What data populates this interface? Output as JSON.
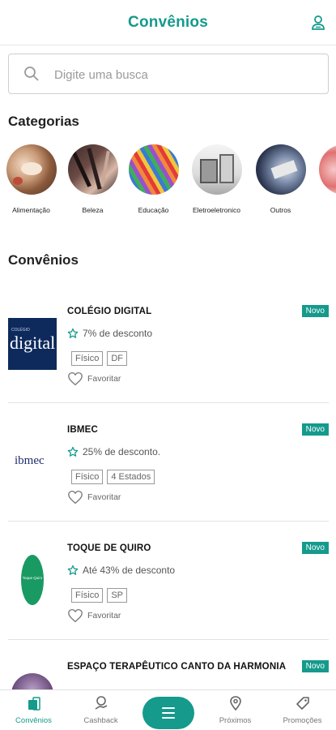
{
  "header": {
    "title": "Convênios",
    "profile_icon": "user-icon"
  },
  "search": {
    "placeholder": "Digite uma busca",
    "icon": "search-icon"
  },
  "categories_title": "Categorias",
  "categories": [
    {
      "label": "Alimentação"
    },
    {
      "label": "Beleza"
    },
    {
      "label": "Educação"
    },
    {
      "label": "Eletroeletronico"
    },
    {
      "label": "Outros"
    }
  ],
  "convenios_title": "Convênios",
  "cards": [
    {
      "name": "COLÉGIO DIGITAL",
      "badge": "Novo",
      "discount": "7% de desconto",
      "tags": [
        "Físico",
        "DF"
      ],
      "fav_label": "Favoritar",
      "logo_text": "digital",
      "logo_subtext": "COLÉGIO"
    },
    {
      "name": "IBMEC",
      "badge": "Novo",
      "discount": "25% de desconto.",
      "tags": [
        "Físico",
        "4 Estados"
      ],
      "fav_label": "Favoritar",
      "logo_text": "ibmec"
    },
    {
      "name": "TOQUE DE QUIRO",
      "badge": "Novo",
      "discount": "Até 43% de desconto",
      "tags": [
        "Físico",
        "SP"
      ],
      "fav_label": "Favoritar",
      "logo_text": "Toque Quiro"
    },
    {
      "name": "ESPAÇO TERAPÊUTICO CANTO DA HARMONIA",
      "badge": "Novo"
    }
  ],
  "bottom_nav": [
    {
      "label": "Convênios",
      "icon": "store-icon",
      "active": true
    },
    {
      "label": "Cashback",
      "icon": "cashback-icon",
      "active": false
    },
    {
      "label": "",
      "icon": "menu-icon",
      "active": false
    },
    {
      "label": "Próximos",
      "icon": "location-pin-icon",
      "active": false
    },
    {
      "label": "Promoções",
      "icon": "tag-icon",
      "active": false
    }
  ],
  "colors": {
    "accent": "#159a8c",
    "badge": "#159a8c",
    "text": "#222222",
    "muted": "#666666"
  }
}
